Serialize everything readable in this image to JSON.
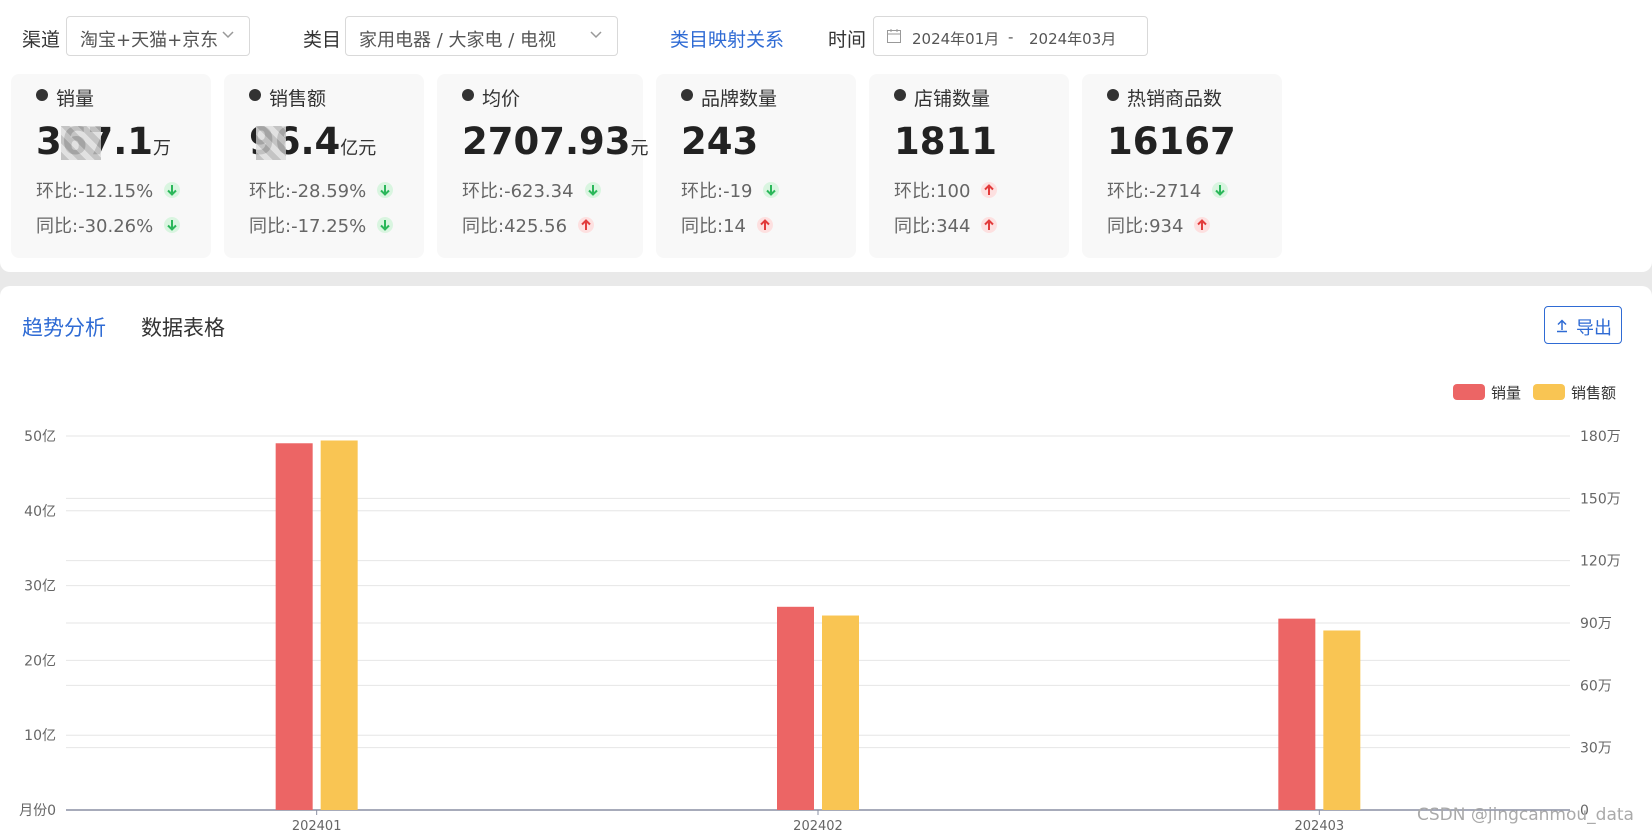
{
  "filters": {
    "channel_label": "渠道",
    "channel_value": "淘宝+天猫+京东",
    "category_label": "类目",
    "category_value": "家用电器 / 大家电 / 电视",
    "mapping_link": "类目映射关系",
    "time_label": "时间",
    "date_start": "2024年01月",
    "date_sep": "-",
    "date_end": "2024年03月"
  },
  "cards": [
    {
      "title": "销量",
      "value": "367.1",
      "unit": "万",
      "mom_label": "环比:",
      "mom": "-12.15%",
      "mom_dir": "down",
      "yoy_label": "同比:",
      "yoy": "-30.26%",
      "yoy_dir": "down"
    },
    {
      "title": "销售额",
      "value": "96.4",
      "unit": "亿元",
      "mom_label": "环比:",
      "mom": "-28.59%",
      "mom_dir": "down",
      "yoy_label": "同比:",
      "yoy": "-17.25%",
      "yoy_dir": "down"
    },
    {
      "title": "均价",
      "value": "2707.93",
      "unit": "元",
      "mom_label": "环比:",
      "mom": "-623.34",
      "mom_dir": "down",
      "yoy_label": "同比:",
      "yoy": "425.56",
      "yoy_dir": "up"
    },
    {
      "title": "品牌数量",
      "value": "243",
      "unit": "",
      "mom_label": "环比:",
      "mom": "-19",
      "mom_dir": "down",
      "yoy_label": "同比:",
      "yoy": "14",
      "yoy_dir": "up"
    },
    {
      "title": "店铺数量",
      "value": "1811",
      "unit": "",
      "mom_label": "环比:",
      "mom": "100",
      "mom_dir": "up",
      "yoy_label": "同比:",
      "yoy": "344",
      "yoy_dir": "up"
    },
    {
      "title": "热销商品数",
      "value": "16167",
      "unit": "",
      "mom_label": "环比:",
      "mom": "-2714",
      "mom_dir": "down",
      "yoy_label": "同比:",
      "yoy": "934",
      "yoy_dir": "up"
    }
  ],
  "tabs": {
    "trend": "趋势分析",
    "table": "数据表格"
  },
  "export_label": "导出",
  "colors": {
    "sales_volume": "#ec6565",
    "sales_amount": "#f9c553",
    "accent": "#2f6bd4",
    "up": "#e23b3b",
    "down": "#2bb75a"
  },
  "chart_data": {
    "type": "bar",
    "categories": [
      "202401",
      "202402",
      "202403"
    ],
    "series": [
      {
        "name": "销量",
        "axis": "right",
        "values": [
          1765000,
          978000,
          921000
        ]
      },
      {
        "name": "销售额",
        "axis": "left",
        "values": [
          4940000000,
          2600000000,
          2400000000
        ]
      }
    ],
    "y_left": {
      "ylim": [
        0,
        5000000000
      ],
      "ticks": [
        0,
        1000000000,
        2000000000,
        3000000000,
        4000000000,
        5000000000
      ],
      "tick_labels": [
        "0",
        "10亿",
        "20亿",
        "30亿",
        "40亿",
        "50亿"
      ],
      "title": "月份"
    },
    "y_right": {
      "ylim": [
        0,
        1800000
      ],
      "ticks": [
        0,
        300000,
        600000,
        900000,
        1200000,
        1500000,
        1800000
      ],
      "tick_labels": [
        "0",
        "30万",
        "60万",
        "90万",
        "120万",
        "150万",
        "180万"
      ]
    },
    "legend": "top-right",
    "grid": true
  },
  "watermark": "CSDN @jingcanmou_data"
}
